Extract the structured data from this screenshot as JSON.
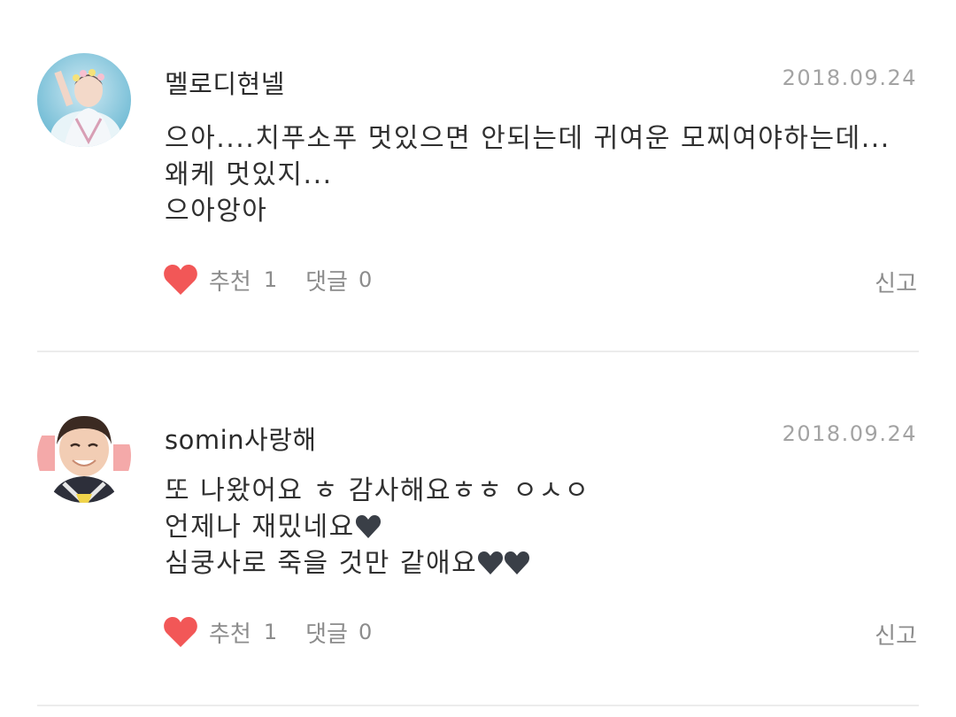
{
  "colors": {
    "heart": "#f25757",
    "muted_text": "#8c8c8c",
    "date_text": "#a3a3a3",
    "divider": "#ececec"
  },
  "comments": [
    {
      "username": "멜로디현넬",
      "date": "2018.09.24",
      "lines": [
        "으아....치푸소푸 멋있으면 안되는데 귀여운 모찌여야하는데...",
        "왜케 멋있지...",
        "으아앙아"
      ],
      "like_label": "추천",
      "like_count": "1",
      "reply_label": "댓글",
      "reply_count": "0",
      "report_label": "신고"
    },
    {
      "username": "somin사랑해",
      "date": "2018.09.24",
      "lines": [
        "또 나왔어요 ㅎ 감사해요ㅎㅎ ㅇㅅㅇ",
        "언제나 재밌네요",
        "심쿵사로 죽을 것만 같애요"
      ],
      "like_label": "추천",
      "like_count": "1",
      "reply_label": "댓글",
      "reply_count": "0",
      "report_label": "신고"
    }
  ]
}
